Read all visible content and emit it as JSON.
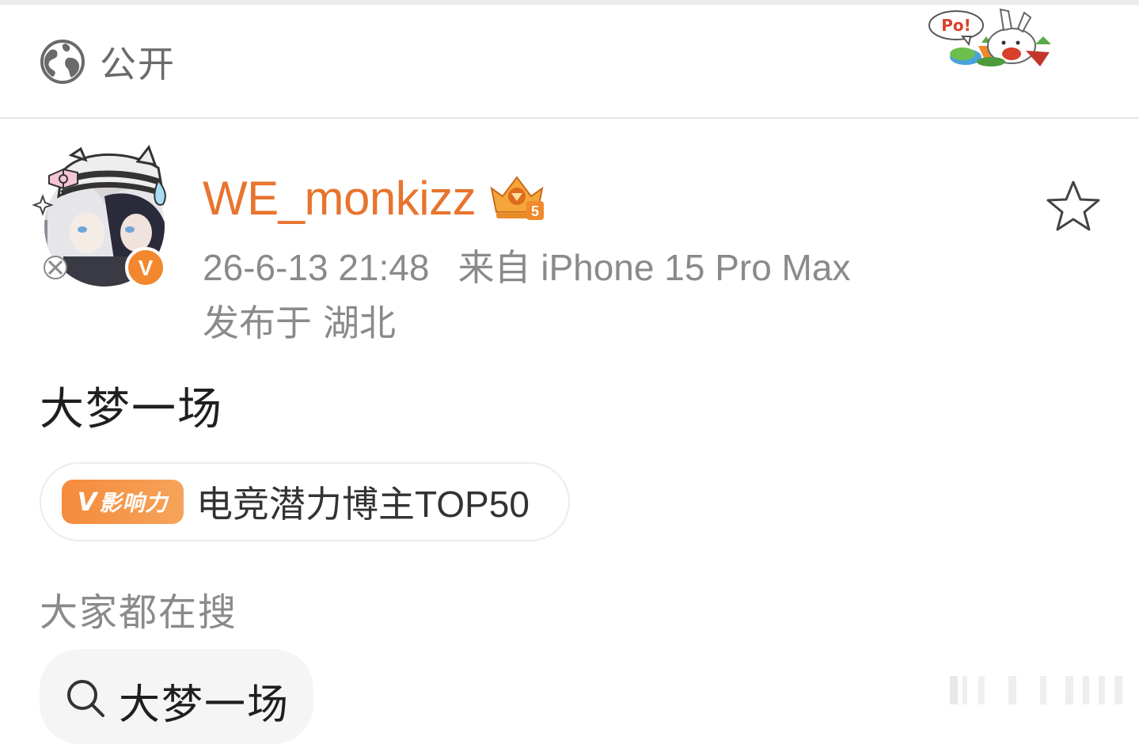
{
  "visibility": {
    "icon": "globe-icon",
    "label": "公开"
  },
  "post": {
    "author": {
      "username": "WE_monkizz",
      "verified_badge": "V",
      "level_badge": "5",
      "username_color": "#e8742e"
    },
    "timestamp": "26-6-13 21:48",
    "source": "来自 iPhone 15 Pro Max",
    "location_label": "发布于",
    "location": "湖北",
    "text": "大梦一场",
    "tag": {
      "badge_v": "V",
      "badge_label": "影响力",
      "text": "电竞潜力博主TOP50",
      "badge_color": "#f58a3c"
    }
  },
  "trending": {
    "title": "大家都在搜",
    "items": [
      {
        "icon": "search-icon",
        "text": "大梦一场"
      }
    ]
  },
  "sticker": {
    "text": "Po!"
  }
}
